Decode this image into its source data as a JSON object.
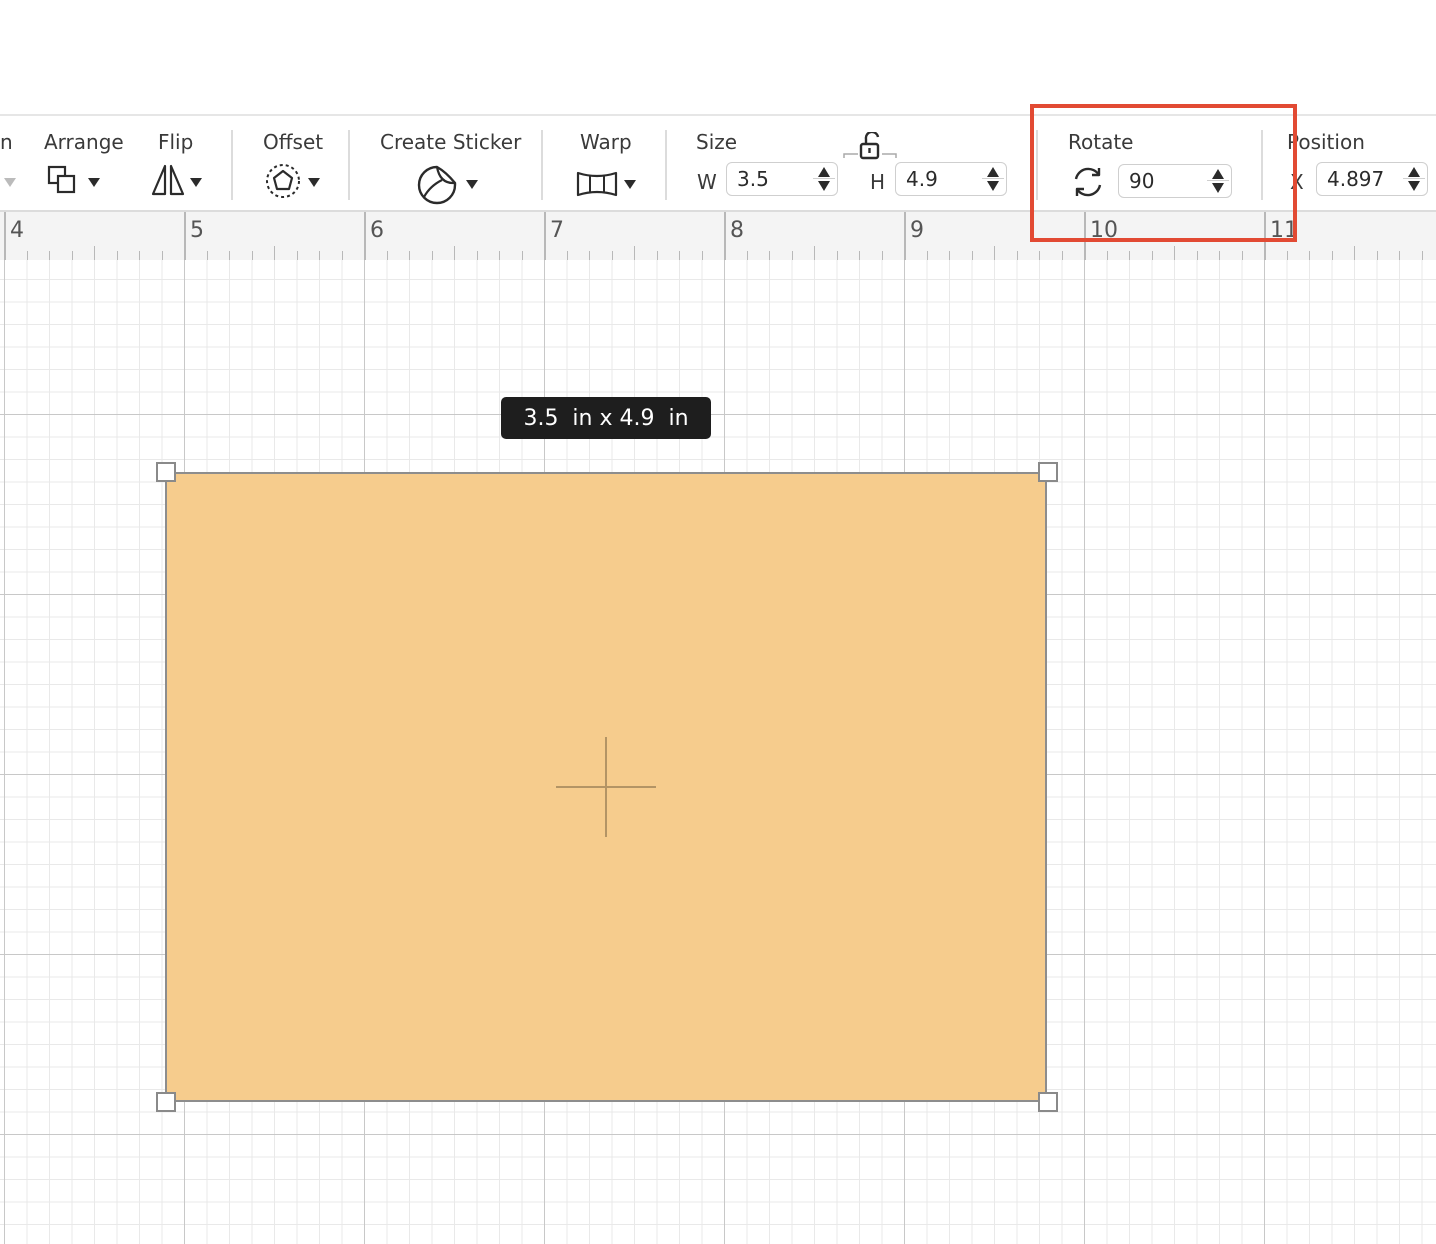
{
  "toolbar": {
    "clipped_left_label": "n",
    "arrange_label": "Arrange",
    "flip_label": "Flip",
    "offset_label": "Offset",
    "create_sticker_label": "Create Sticker",
    "warp_label": "Warp",
    "size_label": "Size",
    "width_prefix": "W",
    "width_value": "3.5",
    "height_prefix": "H",
    "height_value": "4.9",
    "rotate_label": "Rotate",
    "rotate_value": "90",
    "position_label": "Position",
    "x_prefix": "X",
    "x_value": "4.897"
  },
  "ruler": {
    "numbers": [
      "4",
      "5",
      "6",
      "7",
      "8",
      "9",
      "10",
      "11"
    ]
  },
  "canvas": {
    "size_tooltip": "3.5  in x 4.9  in",
    "shape_fill": "#f6cc8d"
  },
  "highlight_color": "#e24a33"
}
